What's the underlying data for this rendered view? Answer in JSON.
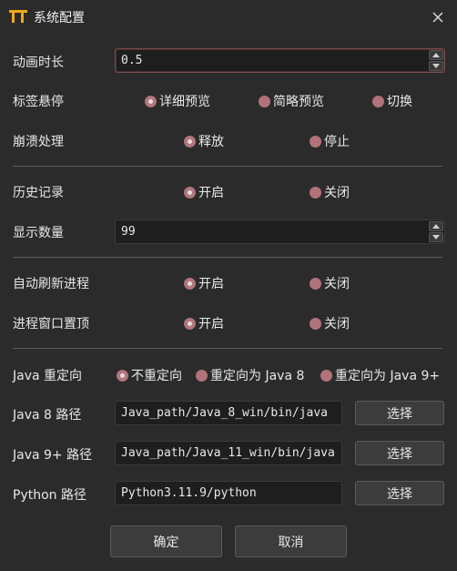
{
  "window": {
    "title": "系统配置",
    "icon": "app-logo-icon",
    "close_icon": "close-icon"
  },
  "animation": {
    "label": "动画时长",
    "value": "0.5"
  },
  "tab_hover": {
    "label": "标签悬停",
    "options": [
      "详细预览",
      "简略预览",
      "切换"
    ],
    "selected": "详细预览"
  },
  "crash": {
    "label": "崩溃处理",
    "options": [
      "释放",
      "停止"
    ],
    "selected": "释放"
  },
  "history": {
    "label": "历史记录",
    "options": [
      "开启",
      "关闭"
    ],
    "selected": "开启"
  },
  "display_count": {
    "label": "显示数量",
    "value": "99"
  },
  "auto_refresh": {
    "label": "自动刷新进程",
    "options": [
      "开启",
      "关闭"
    ],
    "selected": "开启"
  },
  "topmost": {
    "label": "进程窗口置顶",
    "options": [
      "开启",
      "关闭"
    ],
    "selected": "开启"
  },
  "java_redirect": {
    "label": "Java 重定向",
    "options": [
      "不重定向",
      "重定向为 Java 8",
      "重定向为 Java 9+"
    ],
    "selected": "不重定向"
  },
  "java8": {
    "label": "Java 8 路径",
    "value": "Java_path/Java_8_win/bin/java",
    "button": "选择"
  },
  "java9": {
    "label": "Java 9+ 路径",
    "value": "Java_path/Java_11_win/bin/java",
    "button": "选择"
  },
  "python": {
    "label": "Python 路径",
    "value": "Python3.11.9/python",
    "button": "选择"
  },
  "footer": {
    "ok": "确定",
    "cancel": "取消"
  },
  "colors": {
    "background": "#2b2b2b",
    "radio_accent": "#b1727a",
    "field_bg": "#1e1e1e",
    "button_bg": "#3c3c3c"
  }
}
